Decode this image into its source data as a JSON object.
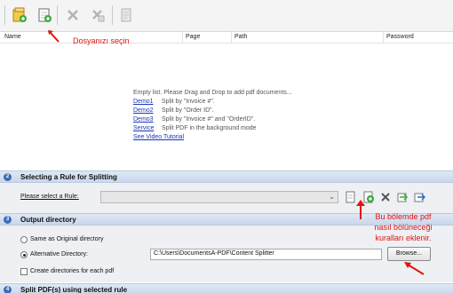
{
  "toolbar": {
    "icons": [
      "add-files-icon",
      "add-folder-icon",
      "remove-icon",
      "remove-all-icon",
      "document-icon"
    ]
  },
  "table": {
    "columns": [
      "Name",
      "Page",
      "Path",
      "Password"
    ]
  },
  "list": {
    "empty_message": "Empty list. Please Drag and Drop to add pdf documents...",
    "demos": [
      {
        "link": "Demo1",
        "desc": "Split by \"Invoice #\"."
      },
      {
        "link": "Demo2",
        "desc": "Split by \"Order ID\"."
      },
      {
        "link": "Demo3",
        "desc": "Split by \"Invoice #\" and \"OrderID\"."
      },
      {
        "link": "Service",
        "desc": "Split PDF in the background mode"
      }
    ],
    "video_link": "See Video Tutorial"
  },
  "section2": {
    "num": "2",
    "title": "Selecting a Rule for Splitting"
  },
  "rule": {
    "label": "Please select a Rule:",
    "value": ""
  },
  "section3": {
    "num": "3",
    "title": "Output directory"
  },
  "output": {
    "same_as_original": "Same as Original directory",
    "alternative": "Alternative Directory:",
    "path": "C:\\Users\\DocumentsA-PDF\\Content Splitter",
    "browse": "Browse...",
    "create_dirs": "Create directories for each pdf"
  },
  "section4": {
    "num": "4",
    "title": "Split PDF(s) using selected rule"
  },
  "annotations": {
    "select_file": "Dosyanızı seçin",
    "rule_line1": "Bu bölemde pdf",
    "rule_line2": "nasıl bölüneceği",
    "rule_line3": "kuralları eklenir."
  },
  "colors": {
    "annotation": "#e0140f",
    "link": "#1a36b8",
    "section": "#c9d7ec"
  }
}
